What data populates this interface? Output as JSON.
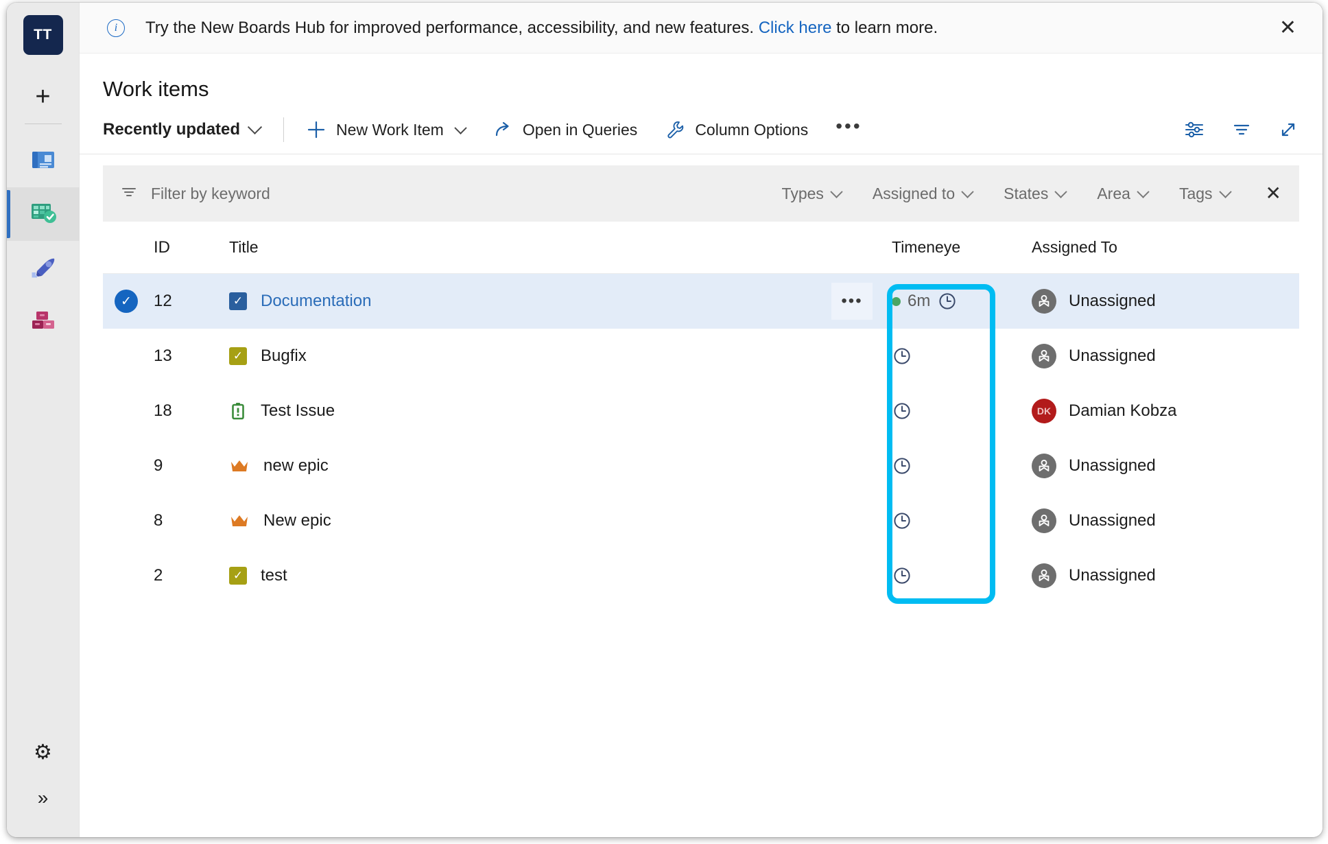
{
  "rail": {
    "org_initials": "TT",
    "add_label": "+",
    "items": [
      {
        "name": "overview",
        "label": "Overview"
      },
      {
        "name": "boards",
        "label": "Boards"
      },
      {
        "name": "repos",
        "label": "Repos"
      },
      {
        "name": "artifacts",
        "label": "Artifacts"
      }
    ],
    "settings_label": "Project settings",
    "expand_label": "Expand"
  },
  "banner": {
    "icon": "info-icon",
    "text_before": "Try the New Boards Hub for improved performance, accessibility, and new features. ",
    "link_text": "Click here",
    "text_after": " to learn more.",
    "close_label": "✕"
  },
  "page": {
    "title": "Work items"
  },
  "toolbar": {
    "pivot_label": "Recently updated",
    "new_work_item_label": "New Work Item",
    "open_in_queries_label": "Open in Queries",
    "column_options_label": "Column Options",
    "more_label": "•••",
    "right_icons": [
      {
        "name": "view-options-icon"
      },
      {
        "name": "filter-icon"
      },
      {
        "name": "full-screen-icon"
      }
    ]
  },
  "filterbar": {
    "keyword_placeholder": "Filter by keyword",
    "keyword_value": "",
    "pills": [
      {
        "label": "Types"
      },
      {
        "label": "Assigned to"
      },
      {
        "label": "States"
      },
      {
        "label": "Area"
      },
      {
        "label": "Tags"
      }
    ],
    "close_label": "✕"
  },
  "table": {
    "columns": [
      "ID",
      "Title",
      "Timeneye",
      "Assigned To"
    ],
    "rows": [
      {
        "selected": true,
        "id": "12",
        "title": "Documentation",
        "type_icon": "task-icon",
        "type_color": "#2a5f9e",
        "timeneye_value": "6m",
        "timeneye_running": true,
        "has_row_menu": true,
        "row_menu_label": "•••",
        "assigned_to": "Unassigned",
        "assigned_initials": "",
        "assigned_avatar": "unassigned-avatar"
      },
      {
        "selected": false,
        "id": "13",
        "title": "Bugfix",
        "type_icon": "bug-icon",
        "type_color": "#a6a014",
        "timeneye_value": "",
        "timeneye_running": false,
        "has_row_menu": false,
        "row_menu_label": "",
        "assigned_to": "Unassigned",
        "assigned_initials": "",
        "assigned_avatar": "unassigned-avatar"
      },
      {
        "selected": false,
        "id": "18",
        "title": "Test Issue",
        "type_icon": "issue-icon",
        "type_color": "#3b8c3b",
        "timeneye_value": "",
        "timeneye_running": false,
        "has_row_menu": false,
        "row_menu_label": "",
        "assigned_to": "Damian Kobza",
        "assigned_initials": "DK",
        "assigned_avatar": "user-avatar"
      },
      {
        "selected": false,
        "id": "9",
        "title": "new epic",
        "type_icon": "epic-crown-icon",
        "type_color": "#dd7a23",
        "timeneye_value": "",
        "timeneye_running": false,
        "has_row_menu": false,
        "row_menu_label": "",
        "assigned_to": "Unassigned",
        "assigned_initials": "",
        "assigned_avatar": "unassigned-avatar"
      },
      {
        "selected": false,
        "id": "8",
        "title": "New epic",
        "type_icon": "epic-crown-icon",
        "type_color": "#dd7a23",
        "timeneye_value": "",
        "timeneye_running": false,
        "has_row_menu": false,
        "row_menu_label": "",
        "assigned_to": "Unassigned",
        "assigned_initials": "",
        "assigned_avatar": "unassigned-avatar"
      },
      {
        "selected": false,
        "id": "2",
        "title": "test",
        "type_icon": "bug-icon",
        "type_color": "#a6a014",
        "timeneye_value": "",
        "timeneye_running": false,
        "has_row_menu": false,
        "row_menu_label": "",
        "assigned_to": "Unassigned",
        "assigned_initials": "",
        "assigned_avatar": "unassigned-avatar"
      }
    ]
  },
  "annotation": {
    "highlight_color": "#00bcf2",
    "highlight_target": "Timeneye column"
  }
}
